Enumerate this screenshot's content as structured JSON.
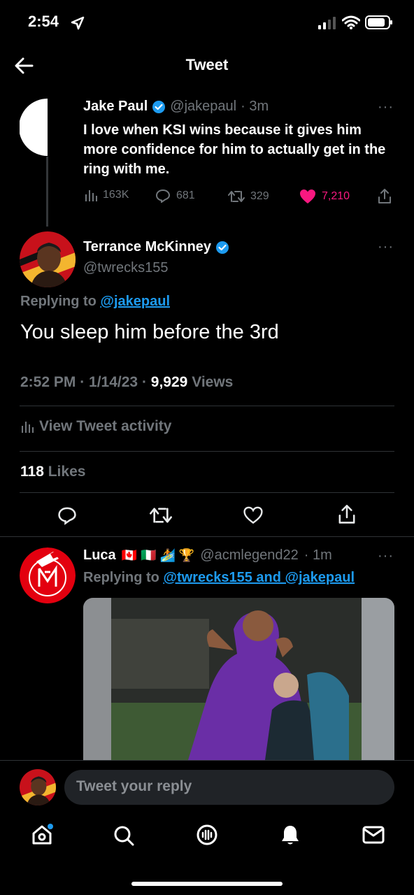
{
  "status": {
    "time": "2:54"
  },
  "header": {
    "title": "Tweet"
  },
  "parent_tweet": {
    "author": "Jake Paul",
    "handle": "@jakepaul",
    "time": "· 3m",
    "text": "I love when KSI wins because it gives him more confidence for him to actually get in the ring with me.",
    "views": "163K",
    "replies": "681",
    "retweets": "329",
    "likes": "7,210",
    "like_color": "#f91880"
  },
  "main_tweet": {
    "author": "Terrance McKinney",
    "handle": "@twrecks155",
    "replying_prefix": "Replying to",
    "replying_to": "@jakepaul",
    "text": "You sleep him before the 3rd",
    "time": "2:52 PM",
    "date": "1/14/23",
    "view_count": "9,929",
    "views_label": "Views",
    "activity_label": "View Tweet activity",
    "likes_count": "118",
    "likes_label": "Likes"
  },
  "reply_tweet": {
    "author": "Luca",
    "author_emojis": "🇨🇦 🇮🇹 🏄 🏆",
    "handle": "@acmlegend22",
    "time": "· 1m",
    "replying_prefix": "Replying to",
    "replying_to": "@twrecks155 and @jakepaul"
  },
  "composer": {
    "placeholder": "Tweet your reply"
  },
  "colors": {
    "accent": "#1d9bf0",
    "verified": "#1d9bf0",
    "background": "#000000"
  },
  "tab_bar": {
    "items": [
      "home-icon",
      "search-icon",
      "spaces-icon",
      "notifications-icon",
      "messages-icon"
    ]
  }
}
